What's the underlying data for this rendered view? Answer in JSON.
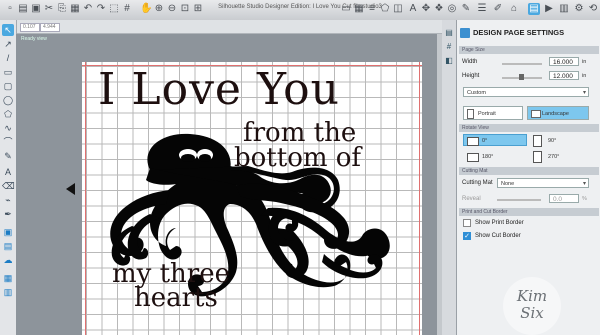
{
  "app": {
    "window_title": "Silhouette Studio Designer Edition: I Love You Cut file.studio3"
  },
  "toolbar": {
    "size_field_1": "0.107",
    "size_field_2": "4.944",
    "workspace_label": "Ready view"
  },
  "design_text": {
    "line1": "I Love You",
    "line2": "from the",
    "line3": "bottom of",
    "line4": "my three",
    "line5": "hearts"
  },
  "panel": {
    "title": "DESIGN PAGE SETTINGS",
    "page_size_section": "Page Size",
    "width_label": "Width",
    "width_value": "16.000",
    "width_unit": "in",
    "height_label": "Height",
    "height_value": "12.000",
    "height_unit": "in",
    "size_preset": "Custom",
    "portrait_label": "Portrait",
    "landscape_label": "Landscape",
    "orientation_selected": "Landscape",
    "rotate_section": "Rotate View",
    "rot_0": "0°",
    "rot_90": "90°",
    "rot_180": "180°",
    "rot_270": "270°",
    "cutting_mat_section": "Cutting Mat",
    "cutting_mat_label": "Cutting Mat",
    "cutting_mat_value": "None",
    "reveal_label": "Reveal",
    "reveal_value": "0.0",
    "reveal_unit": "%",
    "border_section": "Print and Cut Border",
    "show_print_border": "Show Print Border",
    "show_print_border_checked": false,
    "show_cut_border": "Show Cut Border",
    "show_cut_border_checked": true
  },
  "watermark": {
    "line1": "Kim",
    "line2": "Six"
  },
  "colors": {
    "accent": "#4aa8e0",
    "design_fill": "#000000",
    "grid": "#b9b9b9",
    "cut_border": "#e07070"
  }
}
